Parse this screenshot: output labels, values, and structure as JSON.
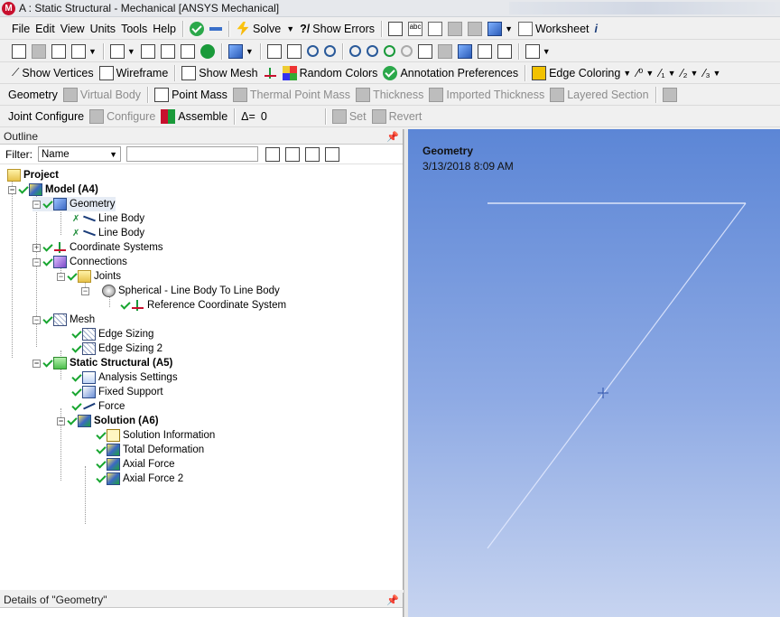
{
  "window": {
    "title": "A : Static Structural - Mechanical [ANSYS Mechanical]",
    "logo": "M"
  },
  "menubar": {
    "items": [
      "File",
      "Edit",
      "View",
      "Units",
      "Tools",
      "Help"
    ],
    "solve": "Solve",
    "show_errors": "Show Errors",
    "worksheet": "Worksheet"
  },
  "displaybar": {
    "show_vertices": "Show Vertices",
    "wireframe": "Wireframe",
    "show_mesh": "Show Mesh",
    "random_colors": "Random Colors",
    "annotation_prefs": "Annotation Preferences",
    "edge_coloring": "Edge Coloring"
  },
  "geombar": {
    "geometry": "Geometry",
    "virtual_body": "Virtual Body",
    "point_mass": "Point Mass",
    "thermal_point_mass": "Thermal Point Mass",
    "thickness": "Thickness",
    "imported_thickness": "Imported Thickness",
    "layered_section": "Layered Section"
  },
  "jointbar": {
    "joint_configure": "Joint Configure",
    "configure": "Configure",
    "assemble": "Assemble",
    "delta_label": "Δ=",
    "delta_value": "0",
    "set": "Set",
    "revert": "Revert"
  },
  "outline": {
    "header": "Outline",
    "filter_label": "Filter:",
    "filter_value": "Name",
    "tree": [
      {
        "label": "Project"
      },
      {
        "label": "Model (A4)"
      },
      {
        "label": "Geometry"
      },
      {
        "label": "Line Body"
      },
      {
        "label": "Line Body"
      },
      {
        "label": "Coordinate Systems"
      },
      {
        "label": "Connections"
      },
      {
        "label": "Joints"
      },
      {
        "label": "Spherical - Line Body To Line Body"
      },
      {
        "label": "Reference Coordinate System"
      },
      {
        "label": "Mesh"
      },
      {
        "label": "Edge Sizing"
      },
      {
        "label": "Edge Sizing 2"
      },
      {
        "label": "Static Structural (A5)"
      },
      {
        "label": "Analysis Settings"
      },
      {
        "label": "Fixed Support"
      },
      {
        "label": "Force"
      },
      {
        "label": "Solution (A6)"
      },
      {
        "label": "Solution Information"
      },
      {
        "label": "Total Deformation"
      },
      {
        "label": "Axial Force"
      },
      {
        "label": "Axial Force 2"
      }
    ]
  },
  "details": {
    "header": "Details of \"Geometry\""
  },
  "viewport": {
    "title": "Geometry",
    "date": "3/13/2018 8:09 AM"
  }
}
